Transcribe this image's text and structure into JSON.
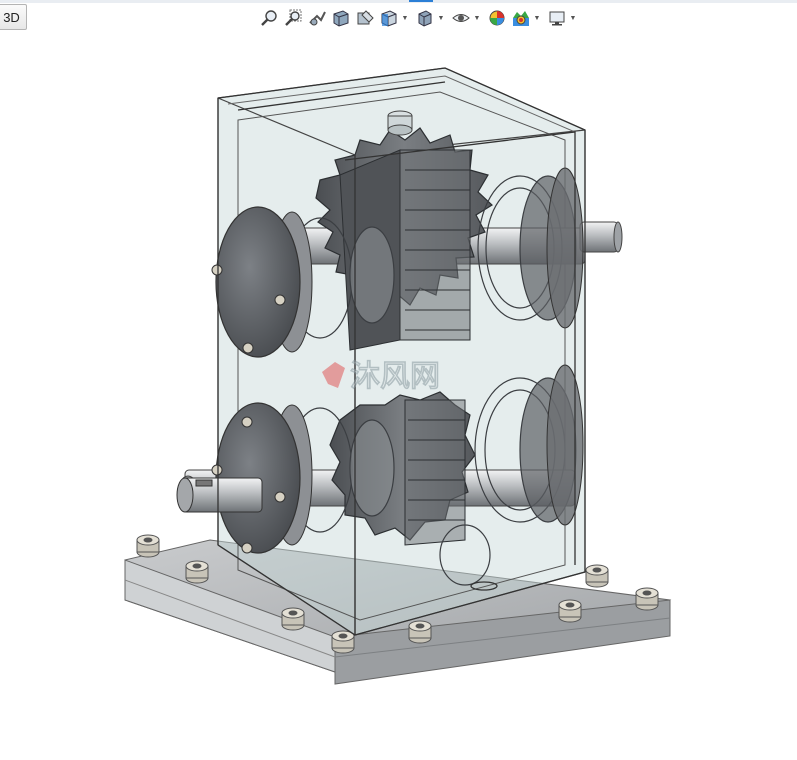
{
  "app": {
    "mode_button_label": "3D"
  },
  "heads_up_toolbar": {
    "tools": [
      {
        "name": "zoom-to-fit-icon",
        "has_dropdown": false
      },
      {
        "name": "zoom-to-area-icon",
        "has_dropdown": false
      },
      {
        "name": "previous-view-icon",
        "has_dropdown": false
      },
      {
        "name": "section-view-icon",
        "has_dropdown": false
      },
      {
        "name": "dynamic-annotation-icon",
        "has_dropdown": false
      },
      {
        "name": "view-orientation-icon",
        "has_dropdown": true
      },
      {
        "name": "display-style-icon",
        "has_dropdown": true
      },
      {
        "name": "hide-show-items-icon",
        "has_dropdown": true
      },
      {
        "name": "edit-appearance-icon",
        "has_dropdown": false
      },
      {
        "name": "apply-scene-icon",
        "has_dropdown": true
      },
      {
        "name": "view-settings-icon",
        "has_dropdown": true
      }
    ],
    "active_indicator_color": "#2b7fd6"
  },
  "model_view": {
    "subject": "gearbox-assembly",
    "housing_color": "#c5d6d8",
    "gear_color": "#5a5d60",
    "base_color": "#b3b5b7",
    "watermark_text": "沐风网"
  }
}
